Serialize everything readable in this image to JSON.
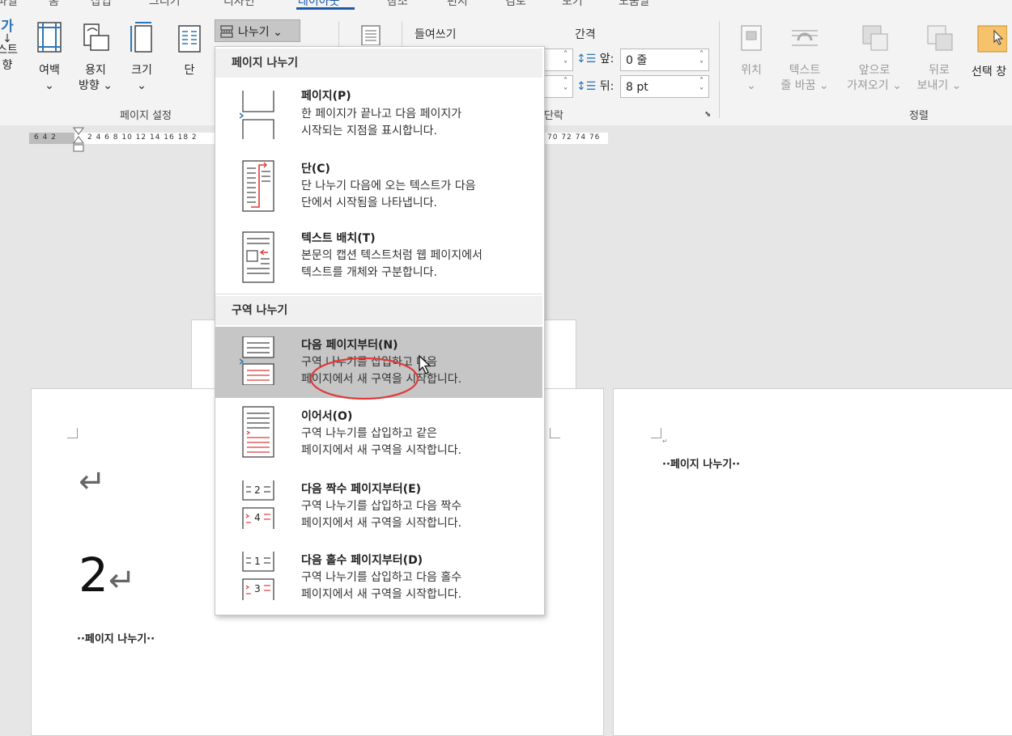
{
  "ribbon": {
    "tabs_partial": [
      "파일",
      "홈",
      "삽입",
      "그리기",
      "디자인",
      "레이아웃",
      "참조",
      "편지",
      "검토",
      "보기",
      "도움말"
    ],
    "page_setup": {
      "group_label": "페이지 설정",
      "buttons": {
        "text_dir_top": "가",
        "text_dir_l1": "스트",
        "text_dir_l2": "향",
        "margins_l1": "여백",
        "margins_l2": "⌄",
        "orientation_l1": "용지",
        "orientation_l2": "방향 ⌄",
        "size_l1": "크기",
        "size_l2": "⌄",
        "columns": "단"
      },
      "breaks_button": "나누기 ⌄"
    },
    "paragraph": {
      "indent_label": "들여쓰기",
      "spacing_label": "간격",
      "before_label": "앞:",
      "before_value": "0 줄",
      "after_label": "뒤:",
      "after_value": "8 pt",
      "group_label": "단락"
    },
    "arrange": {
      "group_label": "정렬",
      "position_l1": "위치",
      "position_l2": "⌄",
      "wrap_l1": "텍스트",
      "wrap_l2": "줄 바꿈 ⌄",
      "forward_l1": "앞으로",
      "forward_l2": "가져오기 ⌄",
      "backward_l1": "뒤로",
      "backward_l2": "보내기 ⌄",
      "selection": "선택 창"
    }
  },
  "ruler": {
    "left_numbers": "6 4 2",
    "numbers": "2 4 6 8 10 12 14 16 18 2",
    "right_numbers": "70 72 74 76"
  },
  "document": {
    "page1": {
      "return_mark": "↵",
      "big_number": "2",
      "page_break_text": "··페이지 나누기··"
    },
    "page2": {
      "small_mark": "↵",
      "page_break_text": "··페이지 나누기··"
    }
  },
  "dropdown": {
    "section1_header": "페이지 나누기",
    "section2_header": "구역 나누기",
    "items": [
      {
        "title": "페이지(P)",
        "desc1": "한 페이지가 끝나고 다음 페이지가",
        "desc2": "시작되는 지점을 표시합니다."
      },
      {
        "title": "단(C)",
        "desc1": "단 나누기 다음에 오는 텍스트가 다음",
        "desc2": "단에서 시작됨을 나타냅니다."
      },
      {
        "title": "텍스트 배치(T)",
        "desc1": "본문의 캡션 텍스트처럼 웹 페이지에서",
        "desc2": "텍스트를 개체와 구분합니다."
      },
      {
        "title": "다음 페이지부터(N)",
        "desc1": "구역 나누기를 삽입하고 다음",
        "desc2": "페이지에서 새 구역을 시작합니다."
      },
      {
        "title": "이어서(O)",
        "desc1": "구역 나누기를 삽입하고 같은",
        "desc2": "페이지에서 새 구역을 시작합니다."
      },
      {
        "title": "다음 짝수 페이지부터(E)",
        "desc1": "구역 나누기를 삽입하고 다음 짝수",
        "desc2": "페이지에서 새 구역을 시작합니다."
      },
      {
        "title": "다음 홀수 페이지부터(D)",
        "desc1": "구역 나누기를 삽입하고 다음 홀수",
        "desc2": "페이지에서 새 구역을 시작합니다."
      }
    ],
    "icon_numbers": {
      "even_top": "2",
      "even_bottom": "4",
      "odd_top": "1",
      "odd_bottom": "3"
    }
  },
  "colors": {
    "accent_red": "#e03a3a",
    "icon_blue": "#2e75b6",
    "selected_bg": "#c6c6c6"
  }
}
